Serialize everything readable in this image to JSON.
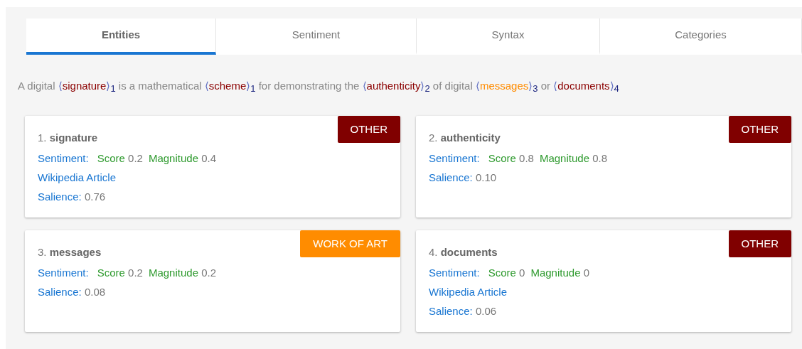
{
  "tabs": [
    {
      "label": "Entities",
      "selected": true
    },
    {
      "label": "Sentiment",
      "selected": false
    },
    {
      "label": "Syntax",
      "selected": false
    },
    {
      "label": "Categories",
      "selected": false
    }
  ],
  "sentence": [
    {
      "kind": "text",
      "text": "A digital "
    },
    {
      "kind": "entity",
      "open": "⟨",
      "text": "signature",
      "close": "⟩",
      "index": "1",
      "color": "#8b0000"
    },
    {
      "kind": "text",
      "text": " is a mathematical "
    },
    {
      "kind": "entity",
      "open": "⟨",
      "text": "scheme",
      "close": "⟩",
      "index": "1",
      "color": "#8b0000"
    },
    {
      "kind": "text",
      "text": " for demonstrating the "
    },
    {
      "kind": "entity",
      "open": "⟨",
      "text": "authenticity",
      "close": "⟩",
      "index": "2",
      "color": "#8b0000"
    },
    {
      "kind": "text",
      "text": " of digital "
    },
    {
      "kind": "entity",
      "open": "⟨",
      "text": "messages",
      "close": "⟩",
      "index": "3",
      "color": "#ff8c00"
    },
    {
      "kind": "text",
      "text": " or "
    },
    {
      "kind": "entity",
      "open": "⟨",
      "text": "documents",
      "close": "⟩",
      "index": "4",
      "color": "#8b0000"
    }
  ],
  "entities": [
    {
      "number": "1.",
      "name": "signature",
      "tag": "OTHER",
      "color": "#800000",
      "sentiment_label": "Sentiment:",
      "score_label": "Score",
      "score": "0.2",
      "magnitude_label": "Magnitude",
      "magnitude": "0.4",
      "link": "Wikipedia Article",
      "salience_label": "Salience:",
      "salience": "0.76"
    },
    {
      "number": "2.",
      "name": "authenticity",
      "tag": "OTHER",
      "color": "#800000",
      "sentiment_label": "Sentiment:",
      "score_label": "Score",
      "score": "0.8",
      "magnitude_label": "Magnitude",
      "magnitude": "0.8",
      "salience_label": "Salience:",
      "salience": "0.10"
    },
    {
      "number": "3.",
      "name": "messages",
      "tag": "WORK OF ART",
      "color": "#ff8c00",
      "sentiment_label": "Sentiment:",
      "score_label": "Score",
      "score": "0.2",
      "magnitude_label": "Magnitude",
      "magnitude": "0.2",
      "salience_label": "Salience:",
      "salience": "0.08"
    },
    {
      "number": "4.",
      "name": "documents",
      "tag": "OTHER",
      "color": "#800000",
      "sentiment_label": "Sentiment:",
      "score_label": "Score",
      "score": "0",
      "magnitude_label": "Magnitude",
      "magnitude": "0",
      "link": "Wikipedia Article",
      "salience_label": "Salience:",
      "salience": "0.06"
    }
  ]
}
